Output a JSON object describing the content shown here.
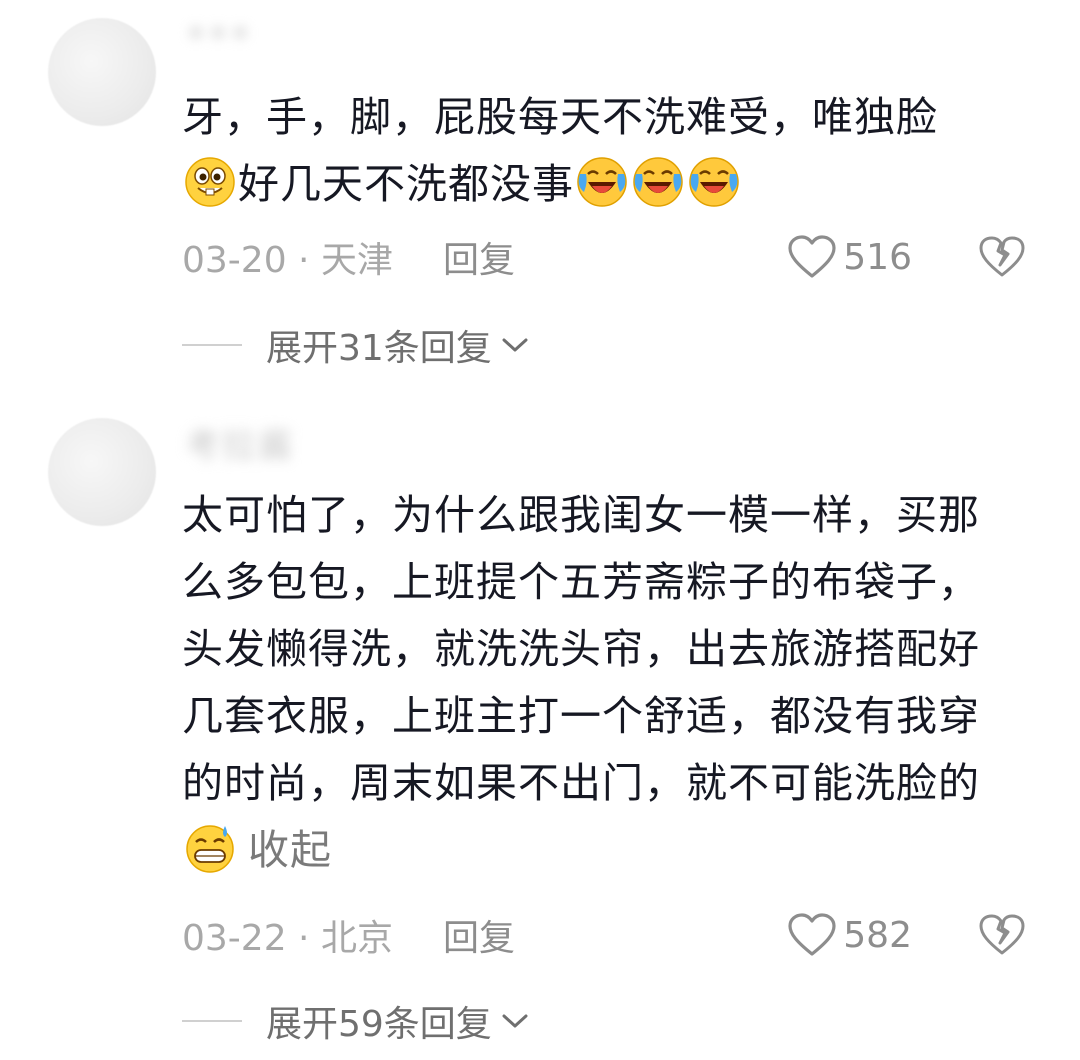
{
  "comments": [
    {
      "username": "•••",
      "text_line1": "牙，手，脚，屁股每天不洗难受，唯独脸",
      "text_line2": "好几天不洗都没事",
      "date_location": "03-20 · 天津",
      "reply_label": "回复",
      "likes": "516",
      "expand_label": "展开31条回复"
    },
    {
      "username": "考拉酱",
      "text": "太可怕了，为什么跟我闺女一模一样，买那么多包包，上班提个五芳斋粽子的布袋子，头发懒得洗，就洗洗头帘，出去旅游搭配好几套衣服，上班主打一个舒适，都没有我穿的时尚，周末如果不出门，就不可能洗脸的",
      "collapse_label": "收起",
      "date_location": "03-22 · 北京",
      "reply_label": "回复",
      "likes": "582",
      "expand_label": "展开59条回复"
    }
  ],
  "icons": {
    "grin_emoji": "grinning-face-emoji",
    "laugh_cry_emoji": "laughing-crying-emoji",
    "sweat_grin_emoji": "grinning-sweat-emoji",
    "like": "heart-outline-icon",
    "dislike": "broken-heart-icon",
    "expand": "chevron-down-icon"
  },
  "colors": {
    "text": "#161823",
    "meta": "#a8a8a8",
    "secondary": "#6f6f6f"
  }
}
